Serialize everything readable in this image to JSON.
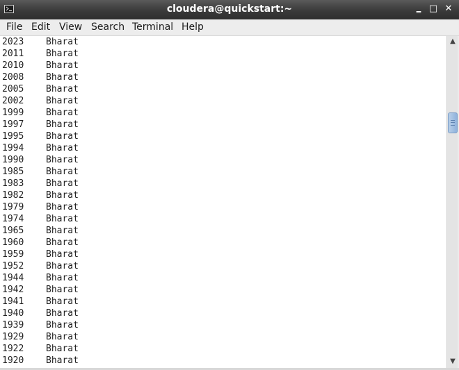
{
  "window": {
    "title": "cloudera@quickstart:~",
    "minimize_glyph": "‗",
    "maximize_glyph": "□",
    "close_glyph": "✕"
  },
  "menu": {
    "items": [
      "File",
      "Edit",
      "View",
      "Search",
      "Terminal",
      "Help"
    ]
  },
  "terminal": {
    "lines": [
      {
        "year": "2023",
        "name": "Bharat"
      },
      {
        "year": "2011",
        "name": "Bharat"
      },
      {
        "year": "2010",
        "name": "Bharat"
      },
      {
        "year": "2008",
        "name": "Bharat"
      },
      {
        "year": "2005",
        "name": "Bharat"
      },
      {
        "year": "2002",
        "name": "Bharat"
      },
      {
        "year": "1999",
        "name": "Bharat"
      },
      {
        "year": "1997",
        "name": "Bharat"
      },
      {
        "year": "1995",
        "name": "Bharat"
      },
      {
        "year": "1994",
        "name": "Bharat"
      },
      {
        "year": "1990",
        "name": "Bharat"
      },
      {
        "year": "1985",
        "name": "Bharat"
      },
      {
        "year": "1983",
        "name": "Bharat"
      },
      {
        "year": "1982",
        "name": "Bharat"
      },
      {
        "year": "1979",
        "name": "Bharat"
      },
      {
        "year": "1974",
        "name": "Bharat"
      },
      {
        "year": "1965",
        "name": "Bharat"
      },
      {
        "year": "1960",
        "name": "Bharat"
      },
      {
        "year": "1959",
        "name": "Bharat"
      },
      {
        "year": "1952",
        "name": "Bharat"
      },
      {
        "year": "1944",
        "name": "Bharat"
      },
      {
        "year": "1942",
        "name": "Bharat"
      },
      {
        "year": "1941",
        "name": "Bharat"
      },
      {
        "year": "1940",
        "name": "Bharat"
      },
      {
        "year": "1939",
        "name": "Bharat"
      },
      {
        "year": "1929",
        "name": "Bharat"
      },
      {
        "year": "1922",
        "name": "Bharat"
      },
      {
        "year": "1920",
        "name": "Bharat"
      }
    ]
  },
  "scrollbar": {
    "up_arrow": "▲",
    "down_arrow": "▼",
    "position_fraction": 0.25
  }
}
